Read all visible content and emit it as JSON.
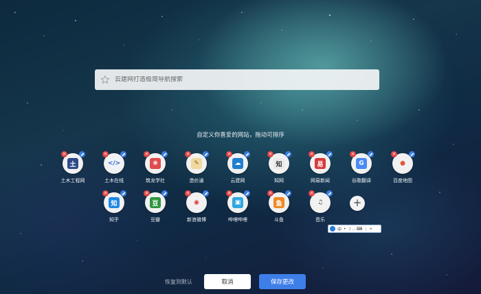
{
  "search": {
    "placeholder": "云建网打造极简导航搜索",
    "icon": "star-icon"
  },
  "hint": "自定义你喜爱的网站，拖动可排序",
  "tiles_row1": [
    {
      "label": "土木工程网",
      "glyph": "土",
      "bg": "#2f4a8a",
      "fg": "#ffffff"
    },
    {
      "label": "土木在线",
      "glyph": "</>",
      "bg": "#eef3fb",
      "fg": "#2e65c6"
    },
    {
      "label": "筑龙学社",
      "glyph": "❀",
      "bg": "#e04b4b",
      "fg": "#ffffff"
    },
    {
      "label": "造价通",
      "glyph": "✎",
      "bg": "#f0d9a0",
      "fg": "#8b6a22"
    },
    {
      "label": "云建网",
      "glyph": "☁",
      "bg": "#1f7fd0",
      "fg": "#ffffff"
    },
    {
      "label": "知网",
      "glyph": "知",
      "bg": "#e9e9e9",
      "fg": "#333333"
    },
    {
      "label": "网易新闻",
      "glyph": "易",
      "bg": "#d93a3a",
      "fg": "#ffffff"
    },
    {
      "label": "谷歌翻译",
      "glyph": "G",
      "bg": "#4a8af4",
      "fg": "#ffffff"
    },
    {
      "label": "百度地图",
      "glyph": "●",
      "bg": "#f2f2f2",
      "fg": "#e1573c"
    }
  ],
  "tiles_row2": [
    {
      "label": "知乎",
      "glyph": "知",
      "bg": "#1e88e5",
      "fg": "#ffffff"
    },
    {
      "label": "豆瓣",
      "glyph": "豆",
      "bg": "#2e963d",
      "fg": "#ffffff"
    },
    {
      "label": "新浪微博",
      "glyph": "◉",
      "bg": "#f2f2f2",
      "fg": "#e0382f"
    },
    {
      "label": "哔哩哔哩",
      "glyph": "▣",
      "bg": "#2fa7e0",
      "fg": "#ffffff"
    },
    {
      "label": "斗鱼",
      "glyph": "鱼",
      "bg": "#f08a24",
      "fg": "#ffffff"
    },
    {
      "label": "音乐",
      "glyph": "♫",
      "bg": "#f2f2f2",
      "fg": "#444444"
    }
  ],
  "add_label": "+",
  "ime": {
    "mode": "中",
    "items": "•  ☽  ‥  ⌨  ⋮  ✧"
  },
  "footer": {
    "restore": "恢复到默认",
    "cancel": "取消",
    "save": "保存更改"
  }
}
